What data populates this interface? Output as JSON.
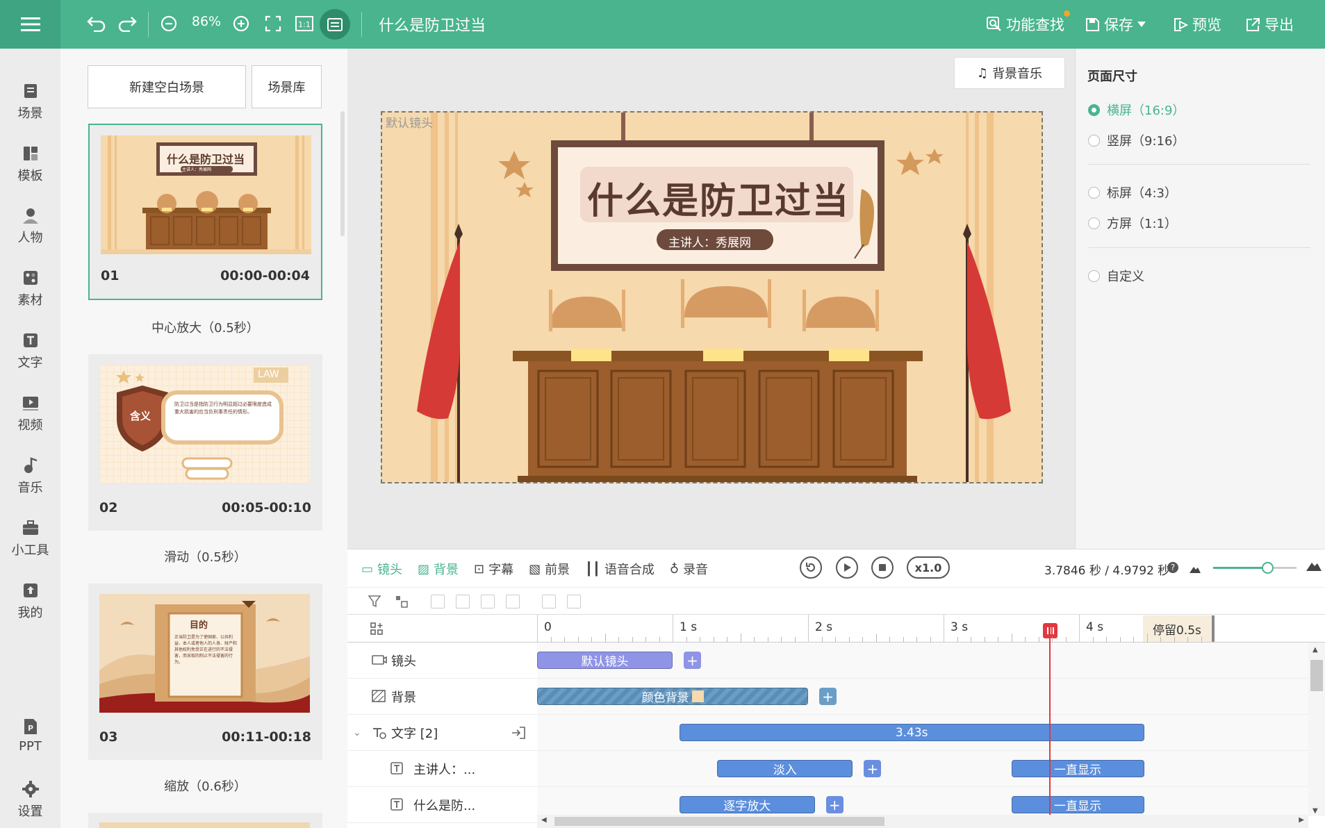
{
  "toolbar": {
    "zoom": "86%",
    "doc_title": "什么是防卫过当",
    "find_label": "功能查找",
    "save_label": "保存",
    "preview_label": "预览",
    "export_label": "导出",
    "accent": "#49b48e"
  },
  "nav": {
    "items": [
      {
        "label": "场景",
        "icon": "scene-icon"
      },
      {
        "label": "模板",
        "icon": "template-icon"
      },
      {
        "label": "人物",
        "icon": "person-icon"
      },
      {
        "label": "素材",
        "icon": "asset-icon"
      },
      {
        "label": "文字",
        "icon": "text-icon"
      },
      {
        "label": "视频",
        "icon": "video-icon"
      },
      {
        "label": "音乐",
        "icon": "music-icon"
      },
      {
        "label": "小工具",
        "icon": "toolbox-icon"
      },
      {
        "label": "我的",
        "icon": "upload-icon"
      },
      {
        "label": "PPT",
        "icon": "ppt-icon"
      },
      {
        "label": "设置",
        "icon": "gear-icon"
      }
    ]
  },
  "scenes": {
    "new_blank": "新建空白场景",
    "library": "场景库",
    "list": [
      {
        "num": "01",
        "time": "00:00-00:04",
        "transition": "中心放大（0.5秒）",
        "thumb_title": "什么是防卫过当",
        "thumb_sub": "主讲人：秀展网"
      },
      {
        "num": "02",
        "time": "00:05-00:10",
        "transition": "滑动（0.5秒）",
        "thumb_badge": "含义",
        "thumb_tag": "LAW",
        "thumb_text": "防卫过当是指防卫行为明显超过必要限度造成重大损害的应当负刑事责任的情形。"
      },
      {
        "num": "03",
        "time": "00:11-00:18",
        "transition": "缩放（0.6秒）",
        "thumb_title": "目的",
        "thumb_text": "正当防卫是为了使国家、公共利益、本人或者他人的人身、财产和其他权利免受正在进行的不法侵害，而采取的制止不法侵害的行为。"
      }
    ]
  },
  "canvas": {
    "bgm_label": "背景音乐",
    "camera_label": "默认镜头",
    "slide_title": "什么是防卫过当",
    "slide_presenter": "主讲人：秀展网"
  },
  "page_size": {
    "title": "页面尺寸",
    "options": [
      "横屏（16:9）",
      "竖屏（9:16）",
      "标屏（4:3）",
      "方屏（1:1）",
      "自定义"
    ],
    "selected": 0
  },
  "timeline": {
    "tabs": [
      "镜头",
      "背景",
      "字幕",
      "前景",
      "语音合成",
      "录音"
    ],
    "active_tabs": [
      0,
      1
    ],
    "speed": "x1.0",
    "time_readout": "3.7846 秒 / 4.9792 秒",
    "zoom_level": 0.65,
    "ruler": [
      "0",
      "1 s",
      "2 s",
      "3 s",
      "4 s"
    ],
    "pause_label": "停留0.5s",
    "playhead_seconds": 3.7846,
    "tracks": [
      {
        "label": "镜头",
        "icon": "camera-icon",
        "clips": [
          {
            "label": "默认镜头",
            "start": 0,
            "end": 1.0,
            "color": "#8f94e6"
          }
        ]
      },
      {
        "label": "背景",
        "icon": "background-icon",
        "clips": [
          {
            "label": "颜色背景",
            "start": 0,
            "end": 2.0,
            "color": "#6b9ec6"
          }
        ]
      },
      {
        "label": "文字 [2]",
        "icon": "text-group-icon",
        "clips": [
          {
            "label": "3.43s",
            "start": 1.05,
            "end": 4.48,
            "color": "#5b8fdd"
          }
        ]
      },
      {
        "label": "主讲人：...",
        "icon": "text-icon",
        "clips": [
          {
            "label": "淡入",
            "start": 1.33,
            "end": 2.33,
            "color": "#5b8fdd"
          },
          {
            "label": "一直显示",
            "start": 3.5,
            "end": 4.48,
            "color": "#5b8fdd"
          }
        ]
      },
      {
        "label": "什么是防...",
        "icon": "text-icon",
        "clips": [
          {
            "label": "逐字放大",
            "start": 1.05,
            "end": 2.05,
            "color": "#5b8fdd"
          },
          {
            "label": "一直显示",
            "start": 3.5,
            "end": 4.48,
            "color": "#5b8fdd"
          }
        ]
      }
    ]
  }
}
